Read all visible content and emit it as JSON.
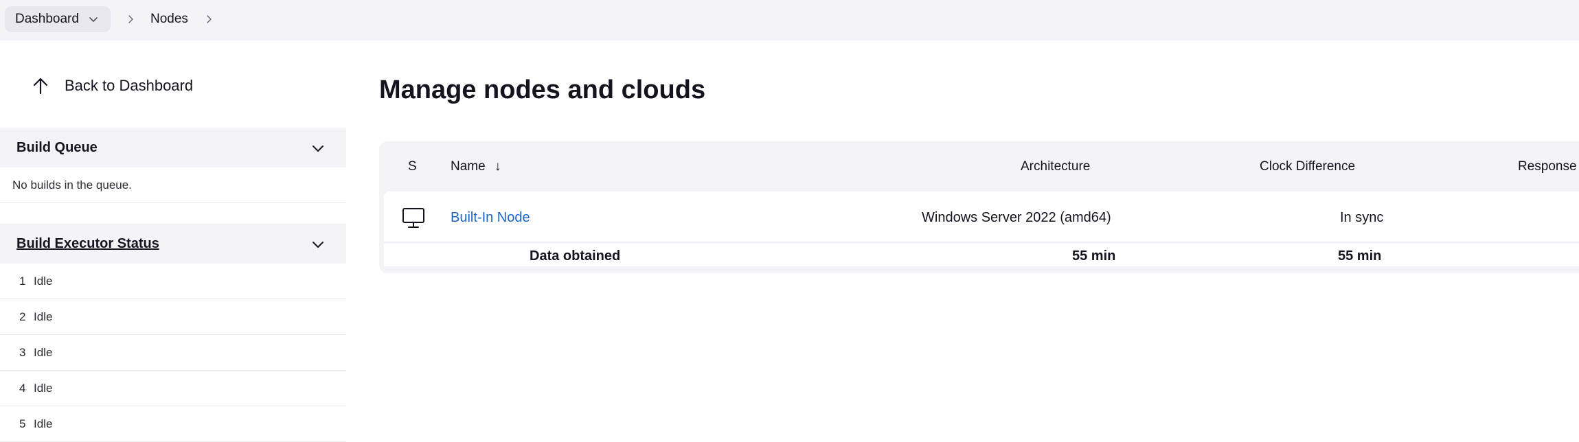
{
  "breadcrumb": {
    "items": [
      {
        "label": "Dashboard"
      },
      {
        "label": "Nodes"
      }
    ]
  },
  "sidebar": {
    "back_label": "Back to Dashboard",
    "build_queue": {
      "title": "Build Queue",
      "empty_text": "No builds in the queue."
    },
    "executor_status": {
      "title": "Build Executor Status",
      "executors": [
        {
          "number": "1",
          "status": "Idle"
        },
        {
          "number": "2",
          "status": "Idle"
        },
        {
          "number": "3",
          "status": "Idle"
        },
        {
          "number": "4",
          "status": "Idle"
        },
        {
          "number": "5",
          "status": "Idle"
        }
      ]
    }
  },
  "main": {
    "title": "Manage nodes and clouds",
    "table": {
      "headers": {
        "status": "S",
        "name": "Name",
        "name_sort": "↓",
        "architecture": "Architecture",
        "clock_difference": "Clock Difference",
        "response_time": "Response"
      },
      "rows": [
        {
          "icon": "computer-icon",
          "name": "Built-In Node",
          "architecture": "Windows Server 2022 (amd64)",
          "clock_difference": "In sync"
        }
      ],
      "footer": {
        "label": "Data obtained",
        "architecture": "55 min",
        "clock_difference": "55 min"
      }
    }
  },
  "colors": {
    "accent_link": "#1a66c8",
    "panel_bg": "#f3f3f8"
  }
}
